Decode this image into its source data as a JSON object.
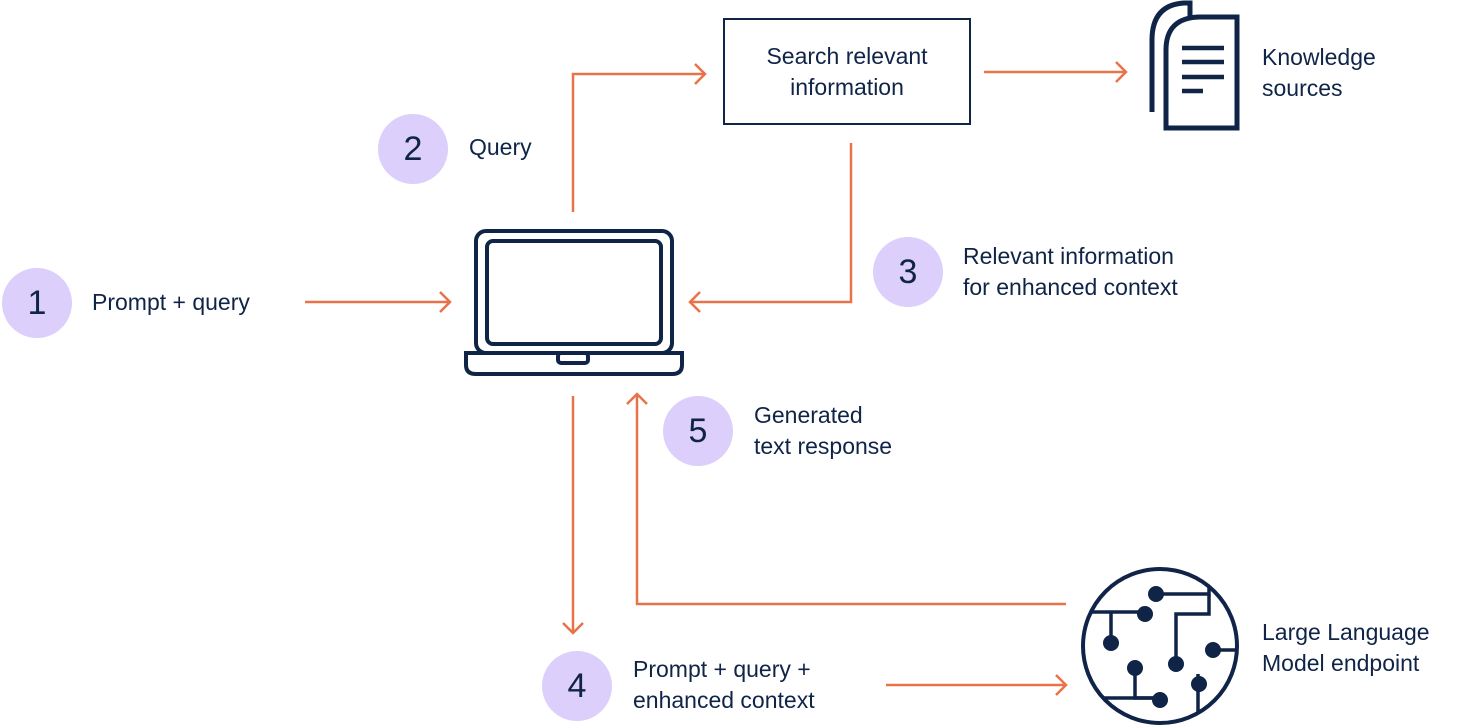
{
  "colors": {
    "arrow": "#e8734a",
    "ink": "#0f2447",
    "badge": "#dccffb"
  },
  "steps": [
    {
      "number": "1",
      "label_lines": [
        "Prompt + query"
      ]
    },
    {
      "number": "2",
      "label_lines": [
        "Query"
      ]
    },
    {
      "number": "3",
      "label_lines": [
        "Relevant information",
        "for enhanced context"
      ]
    },
    {
      "number": "4",
      "label_lines": [
        "Prompt + query +",
        "enhanced context"
      ]
    },
    {
      "number": "5",
      "label_lines": [
        "Generated",
        "text response"
      ]
    }
  ],
  "search_box": {
    "lines": [
      "Search relevant",
      "information"
    ]
  },
  "knowledge": {
    "icon": "documents-icon",
    "lines": [
      "Knowledge",
      "sources"
    ]
  },
  "llm": {
    "icon": "circuit-icon",
    "lines": [
      "Large Language",
      "Model endpoint"
    ]
  },
  "client": {
    "icon": "laptop-icon"
  }
}
